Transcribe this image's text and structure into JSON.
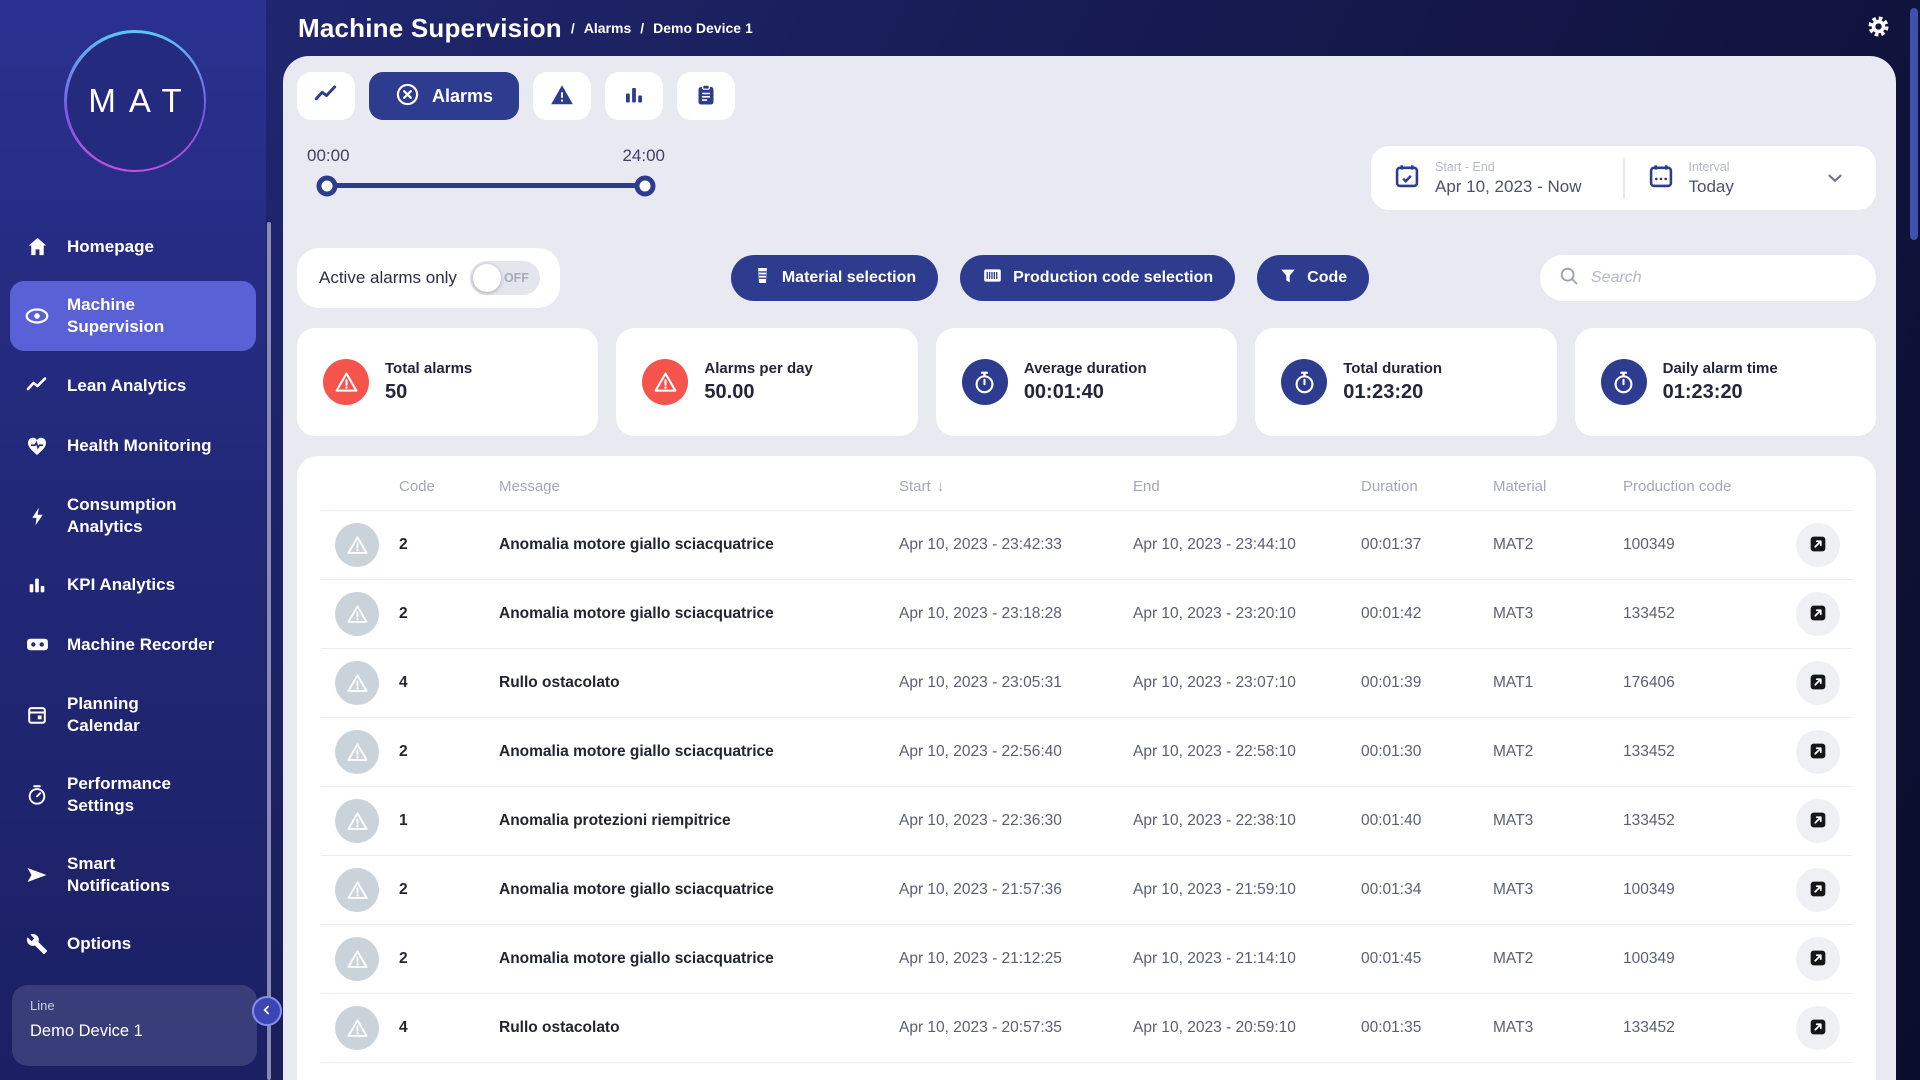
{
  "header": {
    "title": "Machine Supervision",
    "separator": "/",
    "breadcrumbs": [
      "Alarms",
      "Demo Device 1"
    ]
  },
  "sidebar": {
    "logo_text": "MAT",
    "items": [
      {
        "label": "Homepage",
        "lines": [
          "Homepage"
        ],
        "icon": "home-icon",
        "active": false
      },
      {
        "label": "Machine Supervision",
        "lines": [
          "Machine",
          "Supervision"
        ],
        "icon": "eye-icon",
        "active": true
      },
      {
        "label": "Lean Analytics",
        "lines": [
          "Lean Analytics"
        ],
        "icon": "trend-icon",
        "active": false
      },
      {
        "label": "Health Monitoring",
        "lines": [
          "Health Monitoring"
        ],
        "icon": "heart-pulse-icon",
        "active": false
      },
      {
        "label": "Consumption Analytics",
        "lines": [
          "Consumption",
          "Analytics"
        ],
        "icon": "lightning-icon",
        "active": false
      },
      {
        "label": "KPI Analytics",
        "lines": [
          "KPI Analytics"
        ],
        "icon": "bar-chart-icon",
        "active": false
      },
      {
        "label": "Machine Recorder",
        "lines": [
          "Machine Recorder"
        ],
        "icon": "recorder-icon",
        "active": false
      },
      {
        "label": "Planning Calendar",
        "lines": [
          "Planning",
          "Calendar"
        ],
        "icon": "calendar-icon",
        "active": false
      },
      {
        "label": "Performance Settings",
        "lines": [
          "Performance",
          "Settings"
        ],
        "icon": "gauge-icon",
        "active": false
      },
      {
        "label": "Smart Notifications",
        "lines": [
          "Smart",
          "Notifications"
        ],
        "icon": "send-icon",
        "active": false
      },
      {
        "label": "Options",
        "lines": [
          "Options"
        ],
        "icon": "wrench-icon",
        "active": false
      }
    ],
    "line_selector": {
      "label": "Line",
      "value": "Demo Device 1"
    }
  },
  "tabs": [
    {
      "label": "",
      "icon": "trend-chart-icon",
      "active": false
    },
    {
      "label": "Alarms",
      "icon": "circle-x-icon",
      "active": true
    },
    {
      "label": "",
      "icon": "warning-triangle-icon",
      "active": false
    },
    {
      "label": "",
      "icon": "bar-chart-icon",
      "active": false
    },
    {
      "label": "",
      "icon": "clipboard-icon",
      "active": false
    }
  ],
  "time_range": {
    "start_label": "00:00",
    "end_label": "24:00"
  },
  "date_picker": {
    "label": "Start - End",
    "value": "Apr 10, 2023 - Now"
  },
  "interval_picker": {
    "label": "Interval",
    "value": "Today"
  },
  "filters": {
    "active_alarms_label": "Active alarms only",
    "toggle_state": "OFF",
    "buttons": [
      {
        "label": "Material selection",
        "icon": "material-icon"
      },
      {
        "label": "Production code selection",
        "icon": "barcode-icon"
      },
      {
        "label": "Code",
        "icon": "filter-icon"
      }
    ],
    "search_placeholder": "Search"
  },
  "stats": [
    {
      "label": "Total alarms",
      "value": "50",
      "icon": "alert-icon",
      "color": "#f5544c"
    },
    {
      "label": "Alarms per day",
      "value": "50.00",
      "icon": "alert-icon",
      "color": "#f5544c"
    },
    {
      "label": "Average duration",
      "value": "00:01:40",
      "icon": "stopwatch-icon",
      "color": "#2e3c8f"
    },
    {
      "label": "Total duration",
      "value": "01:23:20",
      "icon": "stopwatch-icon",
      "color": "#2e3c8f"
    },
    {
      "label": "Daily alarm time",
      "value": "01:23:20",
      "icon": "stopwatch-icon",
      "color": "#2e3c8f"
    }
  ],
  "table": {
    "columns": [
      "Code",
      "Message",
      "Start",
      "End",
      "Duration",
      "Material",
      "Production code"
    ],
    "sorted_by": "Start",
    "sort_indicator": "↓",
    "rows": [
      {
        "code": "2",
        "message": "Anomalia motore giallo sciacquatrice",
        "start": "Apr 10, 2023 - 23:42:33",
        "end": "Apr 10, 2023 - 23:44:10",
        "duration": "00:01:37",
        "material": "MAT2",
        "production_code": "100349"
      },
      {
        "code": "2",
        "message": "Anomalia motore giallo sciacquatrice",
        "start": "Apr 10, 2023 - 23:18:28",
        "end": "Apr 10, 2023 - 23:20:10",
        "duration": "00:01:42",
        "material": "MAT3",
        "production_code": "133452"
      },
      {
        "code": "4",
        "message": "Rullo ostacolato",
        "start": "Apr 10, 2023 - 23:05:31",
        "end": "Apr 10, 2023 - 23:07:10",
        "duration": "00:01:39",
        "material": "MAT1",
        "production_code": "176406"
      },
      {
        "code": "2",
        "message": "Anomalia motore giallo sciacquatrice",
        "start": "Apr 10, 2023 - 22:56:40",
        "end": "Apr 10, 2023 - 22:58:10",
        "duration": "00:01:30",
        "material": "MAT2",
        "production_code": "133452"
      },
      {
        "code": "1",
        "message": "Anomalia protezioni riempitrice",
        "start": "Apr 10, 2023 - 22:36:30",
        "end": "Apr 10, 2023 - 22:38:10",
        "duration": "00:01:40",
        "material": "MAT3",
        "production_code": "133452"
      },
      {
        "code": "2",
        "message": "Anomalia motore giallo sciacquatrice",
        "start": "Apr 10, 2023 - 21:57:36",
        "end": "Apr 10, 2023 - 21:59:10",
        "duration": "00:01:34",
        "material": "MAT3",
        "production_code": "100349"
      },
      {
        "code": "2",
        "message": "Anomalia motore giallo sciacquatrice",
        "start": "Apr 10, 2023 - 21:12:25",
        "end": "Apr 10, 2023 - 21:14:10",
        "duration": "00:01:45",
        "material": "MAT2",
        "production_code": "100349"
      },
      {
        "code": "4",
        "message": "Rullo ostacolato",
        "start": "Apr 10, 2023 - 20:57:35",
        "end": "Apr 10, 2023 - 20:59:10",
        "duration": "00:01:35",
        "material": "MAT3",
        "production_code": "133452"
      }
    ]
  },
  "colors": {
    "accent": "#2e3c8f",
    "active_item": "#5a61d6",
    "danger": "#f5544c",
    "panel_bg": "#e8e9f1"
  }
}
